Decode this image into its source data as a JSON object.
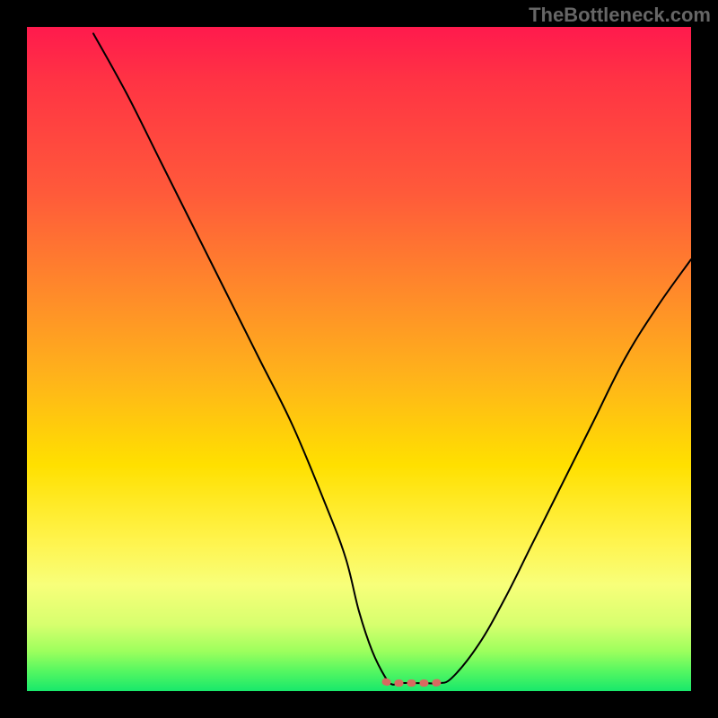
{
  "attribution": "TheBottleneck.com",
  "chart_data": {
    "type": "line",
    "title": "",
    "xlabel": "",
    "ylabel": "",
    "xlim": [
      0,
      100
    ],
    "ylim": [
      0,
      100
    ],
    "grid": false,
    "legend": null,
    "description": "V-shaped bottleneck curve with flat dotted minimum segment on a red-to-green vertical heat gradient background.",
    "series": [
      {
        "name": "bottleneck-curve",
        "x": [
          10,
          15,
          20,
          25,
          30,
          35,
          40,
          45,
          48,
          50,
          52,
          54,
          55,
          56,
          58,
          60,
          62,
          64,
          68,
          72,
          76,
          80,
          85,
          90,
          95,
          100
        ],
        "values": [
          99,
          90,
          80,
          70,
          60,
          50,
          40,
          28,
          20,
          12,
          6,
          2,
          1,
          1.2,
          1.2,
          1.2,
          1.2,
          2,
          7,
          14,
          22,
          30,
          40,
          50,
          58,
          65
        ]
      },
      {
        "name": "minimum-flat-segment",
        "style": "dotted",
        "color": "#d86a60",
        "x": [
          54,
          55,
          56,
          57,
          58,
          59,
          60,
          61,
          62,
          63
        ],
        "values": [
          1.4,
          1.2,
          1.2,
          1.2,
          1.2,
          1.2,
          1.2,
          1.2,
          1.3,
          1.6
        ]
      }
    ],
    "background_gradient_stops": [
      {
        "pos": 0,
        "color": "#ff1a4d"
      },
      {
        "pos": 25,
        "color": "#ff5a3a"
      },
      {
        "pos": 53,
        "color": "#ffb41a"
      },
      {
        "pos": 77,
        "color": "#fff34a"
      },
      {
        "pos": 94,
        "color": "#9dff5d"
      },
      {
        "pos": 100,
        "color": "#18e86b"
      }
    ]
  }
}
